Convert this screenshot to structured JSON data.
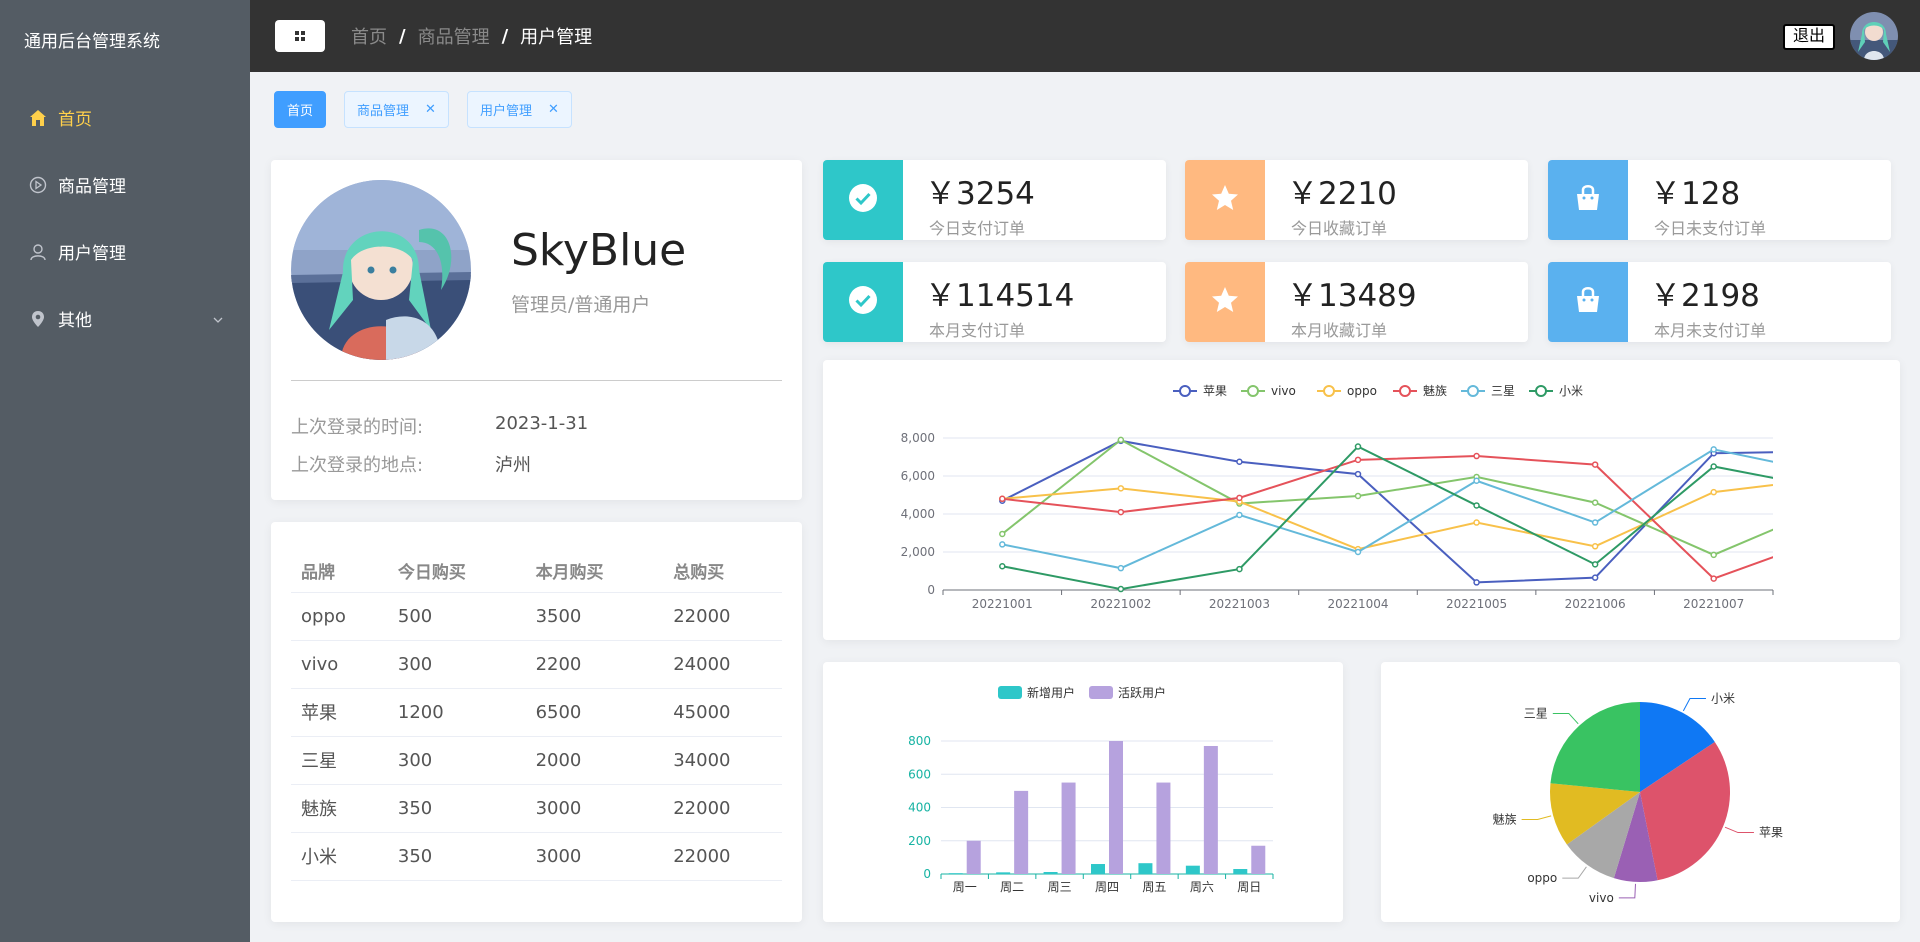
{
  "app": {
    "title": "通用后台管理系统"
  },
  "sidebar": {
    "items": [
      {
        "label": "首页",
        "icon": "home-icon",
        "active": true
      },
      {
        "label": "商品管理",
        "icon": "video-play-icon"
      },
      {
        "label": "用户管理",
        "icon": "user-icon"
      },
      {
        "label": "其他",
        "icon": "location-icon",
        "has_submenu": true
      }
    ]
  },
  "header": {
    "breadcrumb": [
      "首页",
      "商品管理",
      "用户管理"
    ],
    "logout_label": "退出"
  },
  "tags": [
    {
      "label": "首页",
      "active": true,
      "closable": false
    },
    {
      "label": "商品管理",
      "active": false,
      "closable": true
    },
    {
      "label": "用户管理",
      "active": false,
      "closable": true
    }
  ],
  "user": {
    "name": "SkyBlue",
    "role": "管理员/普通用户",
    "last_login_time_label": "上次登录的时间:",
    "last_login_time": "2023-1-31",
    "last_login_place_label": "上次登录的地点:",
    "last_login_place": "泸州"
  },
  "brand_table": {
    "headers": [
      "品牌",
      "今日购买",
      "本月购买",
      "总购买"
    ],
    "rows": [
      [
        "oppo",
        "500",
        "3500",
        "22000"
      ],
      [
        "vivo",
        "300",
        "2200",
        "24000"
      ],
      [
        "苹果",
        "1200",
        "6500",
        "45000"
      ],
      [
        "三星",
        "300",
        "2000",
        "34000"
      ],
      [
        "魅族",
        "350",
        "3000",
        "22000"
      ],
      [
        "小米",
        "350",
        "3000",
        "22000"
      ]
    ]
  },
  "stats": [
    {
      "value": "￥3254",
      "label": "今日支付订单",
      "icon": "success-icon",
      "color": "#2ec7c9"
    },
    {
      "value": "￥2210",
      "label": "今日收藏订单",
      "icon": "star-icon",
      "color": "#ffb980"
    },
    {
      "value": "￥128",
      "label": "今日未支付订单",
      "icon": "shopping-bag-icon",
      "color": "#5ab1ef"
    },
    {
      "value": "￥114514",
      "label": "本月支付订单",
      "icon": "success-icon",
      "color": "#2ec7c9"
    },
    {
      "value": "￥13489",
      "label": "本月收藏订单",
      "icon": "star-icon",
      "color": "#ffb980"
    },
    {
      "value": "￥2198",
      "label": "本月未支付订单",
      "icon": "shopping-bag-icon",
      "color": "#5ab1ef"
    }
  ],
  "chart_data": [
    {
      "type": "line",
      "x": [
        "20221001",
        "20221002",
        "20221003",
        "20221004",
        "20221005",
        "20221006",
        "20221007"
      ],
      "ylim": [
        0,
        8000
      ],
      "yticks": [
        "0",
        "2,000",
        "4,000",
        "6,000",
        "8,000"
      ],
      "legend_position": "top-center",
      "series": [
        {
          "name": "苹果",
          "color": "#4a5fbf",
          "values": [
            4700,
            7850,
            6750,
            6100,
            400,
            650,
            7200,
            7300
          ]
        },
        {
          "name": "vivo",
          "color": "#84c56c",
          "values": [
            2950,
            7900,
            4550,
            4950,
            5950,
            4600,
            1850,
            4500
          ]
        },
        {
          "name": "oppo",
          "color": "#f8c14a",
          "values": [
            4800,
            5350,
            4650,
            2150,
            3550,
            2300,
            5150,
            5900
          ]
        },
        {
          "name": "魅族",
          "color": "#e5525a",
          "values": [
            4800,
            4100,
            4850,
            6850,
            7050,
            6600,
            600,
            2850
          ]
        },
        {
          "name": "三星",
          "color": "#64b9da",
          "values": [
            2400,
            1150,
            3950,
            2000,
            5750,
            3550,
            7400,
            6100
          ]
        },
        {
          "name": "小米",
          "color": "#2e9a65",
          "values": [
            1250,
            50,
            1100,
            7550,
            4450,
            1350,
            6500,
            5300
          ]
        }
      ]
    },
    {
      "type": "bar",
      "categories": [
        "周一",
        "周二",
        "周三",
        "周四",
        "周五",
        "周六",
        "周日"
      ],
      "ylim": [
        0,
        800
      ],
      "yticks": [
        "0",
        "200",
        "400",
        "600",
        "800"
      ],
      "legend_position": "top-center",
      "series": [
        {
          "name": "新增用户",
          "color": "#2ec7c9",
          "values": [
            5,
            10,
            12,
            60,
            65,
            50,
            30
          ]
        },
        {
          "name": "活跃用户",
          "color": "#b6a2de",
          "values": [
            200,
            500,
            550,
            800,
            550,
            770,
            170
          ]
        }
      ]
    },
    {
      "type": "pie",
      "slices": [
        {
          "name": "小米",
          "value": 2999,
          "color": "#0f78f4"
        },
        {
          "name": "苹果",
          "value": 5999,
          "color": "#dd536b"
        },
        {
          "name": "vivo",
          "value": 1500,
          "color": "#9a60b4"
        },
        {
          "name": "oppo",
          "value": 1999,
          "color": "#a8a8a8"
        },
        {
          "name": "魅族",
          "value": 2200,
          "color": "#e1bb22"
        },
        {
          "name": "三星",
          "value": 4500,
          "color": "#39c362"
        }
      ]
    }
  ]
}
